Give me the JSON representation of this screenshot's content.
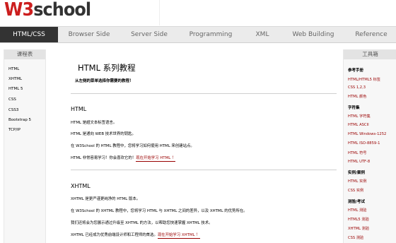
{
  "header": {
    "logo_w3": "W3",
    "logo_rest": "school"
  },
  "nav": [
    {
      "label": "HTML/CSS",
      "active": true
    },
    {
      "label": "Browser Side"
    },
    {
      "label": "Server Side"
    },
    {
      "label": "Programming"
    },
    {
      "label": "XML"
    },
    {
      "label": "Web Building"
    },
    {
      "label": "Reference"
    }
  ],
  "left_sidebar": {
    "title": "课程表",
    "items": [
      "HTML",
      "XHTML",
      "HTML 5",
      "CSS",
      "CSS3",
      "Bootstrap 5",
      "TCP/IP"
    ]
  },
  "main": {
    "title": "HTML 系列教程",
    "hint": "从左侧的菜单选择你需要的教程！",
    "sections": [
      {
        "title": "HTML",
        "paragraphs": [
          "HTML 是超文本标签语言。",
          "HTML 是通向 WEB 技术世界的钥匙。",
          "在 W3School 的 HTML 教程中，您将学习如何使用 HTML 来创建站点。",
          "HTML 非常容易学习！你会喜欢它的！"
        ],
        "link": "现在开始学习 HTML ！"
      },
      {
        "title": "XHTML",
        "paragraphs": [
          "XHTML 是更严谨更纯净的 HTML 版本。",
          "在 W3School 的 XHTML 教程中，您将学习 HTML 与 XHTML 之间的差异，以及 XHTML 的优势所在。",
          "我们还将会为您展示通过升级至 XHTML 的方法，以帮助您快速掌握 XHTML 技术。",
          "XHTML 已经成为优秀前端设计师和工程师的首选。"
        ],
        "link": "现在开始学习 XHTML ！"
      }
    ]
  },
  "right_sidebar": {
    "title": "工具箱",
    "groups": [
      {
        "title": "参考手册",
        "items": [
          "HTML/HTML5 标签",
          "CSS 1,2,3",
          "HTML 颜色"
        ]
      },
      {
        "title": "字符集",
        "items": [
          "HTML 字符集",
          "HTML ASCII",
          "HTML Windows-1252",
          "HTML ISO-8859-1",
          "HTML 符号",
          "HTML UTF-8"
        ]
      },
      {
        "title": "实例/案例",
        "items": [
          "HTML 实例",
          "CSS 实例"
        ]
      },
      {
        "title": "测验/考试",
        "items": [
          "HTML 测验",
          "HTML5 测验",
          "XHTML 测验",
          "CSS 测验"
        ]
      }
    ]
  }
}
